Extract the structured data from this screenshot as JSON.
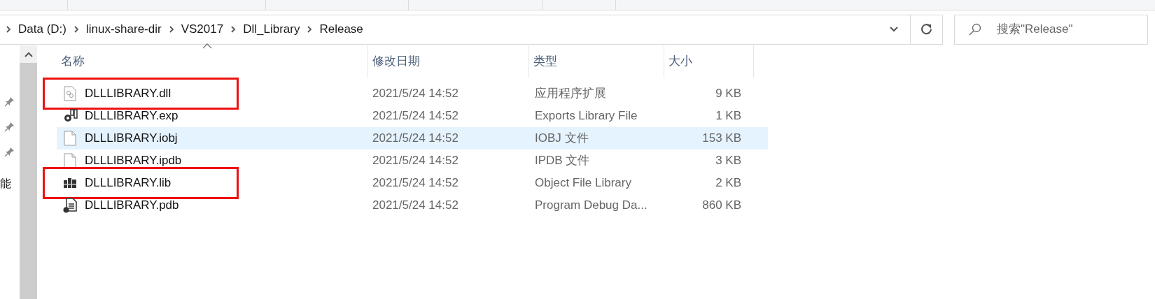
{
  "breadcrumb": [
    {
      "label": "Data (D:)"
    },
    {
      "label": "linux-share-dir"
    },
    {
      "label": "VS2017"
    },
    {
      "label": "Dll_Library"
    },
    {
      "label": "Release"
    }
  ],
  "search": {
    "placeholder": "搜索\"Release\""
  },
  "nav_pane": {
    "pinned": [
      {
        "pinned": true
      },
      {
        "pinned": true
      },
      {
        "pinned": true
      }
    ],
    "partial_label": "能"
  },
  "columns": [
    {
      "label": "名称",
      "sorted": true
    },
    {
      "label": "修改日期",
      "sorted": false
    },
    {
      "label": "类型",
      "sorted": false
    },
    {
      "label": "大小",
      "sorted": false
    }
  ],
  "files": [
    {
      "kind": "dll",
      "name": "DLLLIBRARY.dll",
      "modified": "2021/5/24 14:52",
      "type": "应用程序扩展",
      "size": "9 KB",
      "hovered": false,
      "annotated": true
    },
    {
      "kind": "exp",
      "name": "DLLLIBRARY.exp",
      "modified": "2021/5/24 14:52",
      "type": "Exports Library File",
      "size": "1 KB",
      "hovered": false,
      "annotated": false
    },
    {
      "kind": "blank",
      "name": "DLLLIBRARY.iobj",
      "modified": "2021/5/24 14:52",
      "type": "IOBJ 文件",
      "size": "153 KB",
      "hovered": true,
      "annotated": false
    },
    {
      "kind": "blank",
      "name": "DLLLIBRARY.ipdb",
      "modified": "2021/5/24 14:52",
      "type": "IPDB 文件",
      "size": "3 KB",
      "hovered": false,
      "annotated": false
    },
    {
      "kind": "lib",
      "name": "DLLLIBRARY.lib",
      "modified": "2021/5/24 14:52",
      "type": "Object File Library",
      "size": "2 KB",
      "hovered": false,
      "annotated": true
    },
    {
      "kind": "pdb",
      "name": "DLLLIBRARY.pdb",
      "modified": "2021/5/24 14:52",
      "type": "Program Debug Da...",
      "size": "860 KB",
      "hovered": false,
      "annotated": false
    }
  ]
}
